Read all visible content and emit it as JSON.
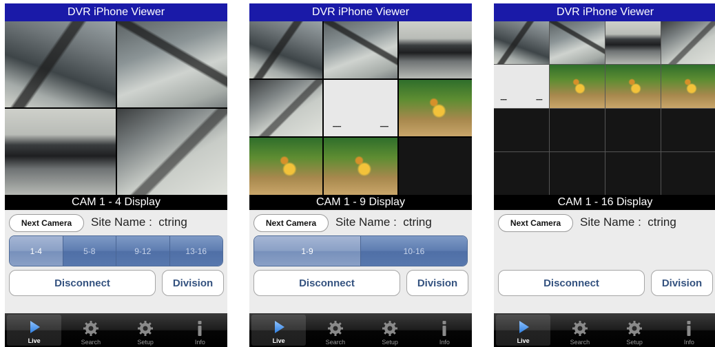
{
  "screens": [
    {
      "title": "DVR iPhone Viewer",
      "display_label": "CAM 1 - 4 Display",
      "next_camera_label": "Next Camera",
      "site_name_label": "Site Name :  ctring",
      "segments": [
        {
          "label": "1-4",
          "active": true
        },
        {
          "label": "5-8",
          "active": false
        },
        {
          "label": "9-12",
          "active": false
        },
        {
          "label": "13-16",
          "active": false
        }
      ],
      "disconnect_label": "Disconnect",
      "division_label": "Division"
    },
    {
      "title": "DVR iPhone Viewer",
      "display_label": "CAM 1 - 9 Display",
      "next_camera_label": "Next Camera",
      "site_name_label": "Site Name :  ctring",
      "segments": [
        {
          "label": "1-9",
          "active": true
        },
        {
          "label": "10-16",
          "active": false
        }
      ],
      "disconnect_label": "Disconnect",
      "division_label": "Division"
    },
    {
      "title": "DVR iPhone Viewer",
      "display_label": "CAM 1 - 16 Display",
      "next_camera_label": "Next Camera",
      "site_name_label": "Site Name :  ctring",
      "segments": [],
      "disconnect_label": "Disconnect",
      "division_label": "Division"
    }
  ],
  "tabs": [
    {
      "label": "Live",
      "icon": "play-icon",
      "active": true
    },
    {
      "label": "Search",
      "icon": "gear-icon",
      "active": false
    },
    {
      "label": "Setup",
      "icon": "gear-icon",
      "active": false
    },
    {
      "label": "Info",
      "icon": "info-icon",
      "active": false
    }
  ],
  "colors": {
    "title_bar": "#1a1aa8",
    "segment_blue": "#5d7cb0",
    "button_text": "#34527f"
  }
}
